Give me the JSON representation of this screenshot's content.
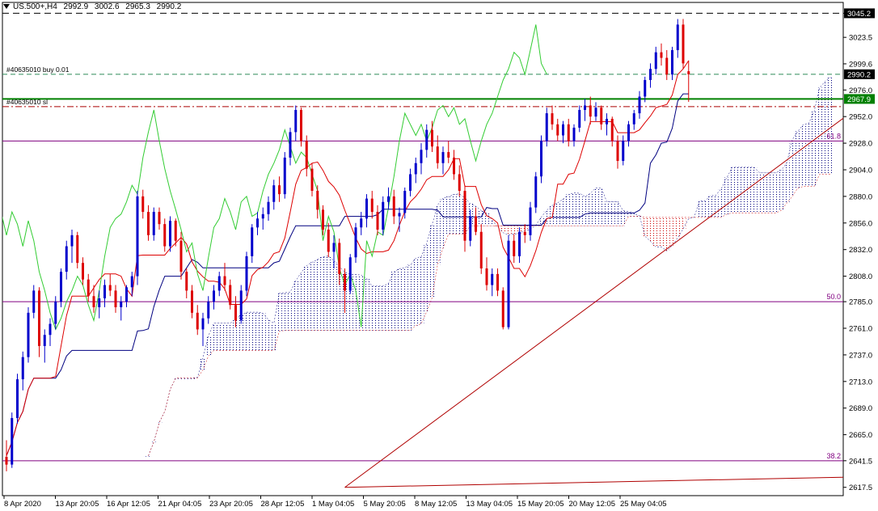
{
  "header": {
    "symbol": "US.500+,H4",
    "open": "2992.9",
    "high": "3002.6",
    "low": "2965.3",
    "close": "2990.2"
  },
  "colors": {
    "background": "#ffffff",
    "axis": "#000000",
    "bull": "#0000cc",
    "bear": "#dd0000",
    "tenkan": "#dd0000",
    "kijun": "#000080",
    "chikou": "#33cc33",
    "cloud_bull": "#000080",
    "cloud_bear": "#cc0000",
    "fibo": "#800080",
    "trendline": "#b00000",
    "order_line": "#008000",
    "sl_line": "#aa0000"
  },
  "chart_data": {
    "type": "candlestick",
    "timeframe": "H4",
    "ylim": [
      2610,
      3055
    ],
    "y_ticks": [
      "3045.2",
      "3023.5",
      "2999.6",
      "2976.0",
      "2952.0",
      "2928.0",
      "2904.0",
      "2880.0",
      "2856.0",
      "2832.0",
      "2808.0",
      "2785.0",
      "2761.0",
      "2737.0",
      "2713.0",
      "2689.0",
      "2665.0",
      "2641.5",
      "2617.5"
    ],
    "x_tick_labels": [
      "8 Apr 2020",
      "13 Apr 20:05",
      "16 Apr 12:05",
      "21 Apr 04:05",
      "23 Apr 20:05",
      "28 Apr 12:05",
      "1 May 04:05",
      "5 May 20:05",
      "8 May 12:05",
      "13 May 04:05",
      "15 May 20:05",
      "20 May 12:05",
      "25 May 04:05"
    ],
    "price_tags": [
      {
        "label": "3045.2",
        "value": 3045.2,
        "style": "dark"
      },
      {
        "label": "2990.2",
        "value": 2990.2,
        "style": "dark"
      },
      {
        "label": "2967.9",
        "value": 2967.9,
        "style": "green"
      }
    ],
    "horizontal_lines": [
      {
        "name": "ask-level",
        "value": 3045.2,
        "style": "dashed"
      },
      {
        "name": "order",
        "label": "#40635010 buy 0.01",
        "value": 2990.2,
        "style": "dash-green"
      },
      {
        "name": "order-sl",
        "label": "#40635010 sl",
        "value": 2961.0,
        "style": "dash-dot-red"
      },
      {
        "name": "current",
        "value": 2967.9,
        "style": "solid-green"
      }
    ],
    "fibonacci": [
      {
        "label": "61.8",
        "value": 2930.0
      },
      {
        "label": "50.0",
        "value": 2785.0
      },
      {
        "label": "38.2",
        "value": 2641.5
      }
    ],
    "trendlines": [
      {
        "from": [
          62,
          2617.5
        ],
        "to": [
          182,
          3055
        ]
      },
      {
        "from": [
          62,
          2617.5
        ],
        "to": [
          217,
          2633
        ]
      }
    ],
    "candles": [
      [
        2645,
        2660,
        2632,
        2638
      ],
      [
        2638,
        2685,
        2635,
        2680
      ],
      [
        2680,
        2720,
        2675,
        2715
      ],
      [
        2715,
        2740,
        2705,
        2735
      ],
      [
        2735,
        2780,
        2730,
        2775
      ],
      [
        2775,
        2800,
        2770,
        2795
      ],
      [
        2795,
        2798,
        2735,
        2745
      ],
      [
        2745,
        2760,
        2730,
        2755
      ],
      [
        2755,
        2770,
        2745,
        2765
      ],
      [
        2765,
        2790,
        2760,
        2785
      ],
      [
        2785,
        2815,
        2780,
        2812
      ],
      [
        2812,
        2840,
        2805,
        2835
      ],
      [
        2835,
        2850,
        2820,
        2845
      ],
      [
        2845,
        2848,
        2815,
        2820
      ],
      [
        2820,
        2825,
        2800,
        2805
      ],
      [
        2805,
        2810,
        2785,
        2790
      ],
      [
        2790,
        2800,
        2775,
        2780
      ],
      [
        2780,
        2795,
        2770,
        2788
      ],
      [
        2788,
        2805,
        2780,
        2800
      ],
      [
        2800,
        2810,
        2790,
        2795
      ],
      [
        2795,
        2800,
        2775,
        2780
      ],
      [
        2780,
        2790,
        2768,
        2785
      ],
      [
        2785,
        2800,
        2780,
        2798
      ],
      [
        2798,
        2812,
        2790,
        2808
      ],
      [
        2808,
        2885,
        2800,
        2880
      ],
      [
        2880,
        2886,
        2860,
        2866
      ],
      [
        2866,
        2872,
        2840,
        2845
      ],
      [
        2845,
        2870,
        2840,
        2866
      ],
      [
        2866,
        2870,
        2850,
        2855
      ],
      [
        2855,
        2860,
        2830,
        2835
      ],
      [
        2835,
        2862,
        2830,
        2858
      ],
      [
        2858,
        2860,
        2835,
        2840
      ],
      [
        2840,
        2848,
        2805,
        2812
      ],
      [
        2812,
        2815,
        2788,
        2795
      ],
      [
        2795,
        2800,
        2770,
        2775
      ],
      [
        2775,
        2782,
        2755,
        2760
      ],
      [
        2760,
        2775,
        2745,
        2770
      ],
      [
        2770,
        2790,
        2765,
        2785
      ],
      [
        2785,
        2800,
        2778,
        2795
      ],
      [
        2795,
        2812,
        2790,
        2808
      ],
      [
        2808,
        2820,
        2795,
        2800
      ],
      [
        2800,
        2805,
        2778,
        2782
      ],
      [
        2782,
        2790,
        2762,
        2768
      ],
      [
        2768,
        2800,
        2765,
        2795
      ],
      [
        2795,
        2830,
        2790,
        2826
      ],
      [
        2826,
        2855,
        2820,
        2852
      ],
      [
        2852,
        2866,
        2845,
        2860
      ],
      [
        2860,
        2870,
        2850,
        2864
      ],
      [
        2864,
        2880,
        2858,
        2875
      ],
      [
        2875,
        2895,
        2868,
        2890
      ],
      [
        2890,
        2898,
        2875,
        2882
      ],
      [
        2882,
        2920,
        2878,
        2915
      ],
      [
        2915,
        2942,
        2908,
        2938
      ],
      [
        2938,
        2962,
        2930,
        2958
      ],
      [
        2958,
        2960,
        2925,
        2930
      ],
      [
        2930,
        2935,
        2898,
        2905
      ],
      [
        2905,
        2910,
        2880,
        2885
      ],
      [
        2885,
        2890,
        2860,
        2868
      ],
      [
        2868,
        2872,
        2845,
        2850
      ],
      [
        2850,
        2856,
        2825,
        2830
      ],
      [
        2830,
        2845,
        2815,
        2838
      ],
      [
        2838,
        2842,
        2800,
        2810
      ],
      [
        2810,
        2815,
        2775,
        2795
      ],
      [
        2795,
        2828,
        2792,
        2825
      ],
      [
        2825,
        2856,
        2820,
        2852
      ],
      [
        2852,
        2866,
        2845,
        2860
      ],
      [
        2860,
        2882,
        2852,
        2878
      ],
      [
        2878,
        2885,
        2860,
        2866
      ],
      [
        2866,
        2872,
        2845,
        2850
      ],
      [
        2850,
        2880,
        2845,
        2875
      ],
      [
        2875,
        2888,
        2868,
        2880
      ],
      [
        2880,
        2886,
        2855,
        2862
      ],
      [
        2862,
        2870,
        2848,
        2865
      ],
      [
        2865,
        2888,
        2860,
        2885
      ],
      [
        2885,
        2905,
        2880,
        2900
      ],
      [
        2900,
        2915,
        2892,
        2910
      ],
      [
        2910,
        2928,
        2900,
        2922
      ],
      [
        2922,
        2945,
        2915,
        2940
      ],
      [
        2940,
        2948,
        2920,
        2925
      ],
      [
        2925,
        2935,
        2905,
        2910
      ],
      [
        2910,
        2925,
        2900,
        2920
      ],
      [
        2920,
        2930,
        2910,
        2915
      ],
      [
        2915,
        2922,
        2895,
        2900
      ],
      [
        2900,
        2908,
        2880,
        2885
      ],
      [
        2885,
        2890,
        2830,
        2840
      ],
      [
        2840,
        2868,
        2835,
        2862
      ],
      [
        2862,
        2870,
        2845,
        2848
      ],
      [
        2848,
        2855,
        2810,
        2815
      ],
      [
        2815,
        2825,
        2795,
        2800
      ],
      [
        2800,
        2815,
        2790,
        2810
      ],
      [
        2810,
        2815,
        2790,
        2795
      ],
      [
        2795,
        2798,
        2760,
        2762
      ],
      [
        2762,
        2845,
        2760,
        2840
      ],
      [
        2840,
        2846,
        2820,
        2826
      ],
      [
        2826,
        2852,
        2820,
        2848
      ],
      [
        2848,
        2855,
        2838,
        2845
      ],
      [
        2845,
        2875,
        2840,
        2870
      ],
      [
        2870,
        2902,
        2865,
        2898
      ],
      [
        2898,
        2935,
        2892,
        2930
      ],
      [
        2930,
        2960,
        2925,
        2955
      ],
      [
        2955,
        2962,
        2940,
        2945
      ],
      [
        2945,
        2950,
        2930,
        2935
      ],
      [
        2935,
        2948,
        2928,
        2945
      ],
      [
        2945,
        2950,
        2925,
        2930
      ],
      [
        2930,
        2945,
        2925,
        2942
      ],
      [
        2942,
        2962,
        2938,
        2958
      ],
      [
        2958,
        2968,
        2948,
        2962
      ],
      [
        2962,
        2970,
        2945,
        2952
      ],
      [
        2952,
        2965,
        2948,
        2960
      ],
      [
        2960,
        2962,
        2940,
        2945
      ],
      [
        2945,
        2955,
        2935,
        2950
      ],
      [
        2950,
        2952,
        2925,
        2930
      ],
      [
        2930,
        2935,
        2905,
        2912
      ],
      [
        2912,
        2935,
        2908,
        2930
      ],
      [
        2930,
        2948,
        2925,
        2945
      ],
      [
        2945,
        2958,
        2940,
        2955
      ],
      [
        2955,
        2975,
        2950,
        2970
      ],
      [
        2970,
        2988,
        2965,
        2985
      ],
      [
        2985,
        3000,
        2978,
        2995
      ],
      [
        2995,
        3015,
        2990,
        3010
      ],
      [
        3010,
        3018,
        2998,
        3005
      ],
      [
        3005,
        3012,
        2985,
        2990
      ],
      [
        2990,
        3015,
        2985,
        3012
      ],
      [
        3012,
        3040,
        3005,
        3035
      ],
      [
        3035,
        3040,
        2995,
        3000
      ],
      [
        2992.9,
        3002.6,
        2965.3,
        2990.2
      ]
    ]
  }
}
